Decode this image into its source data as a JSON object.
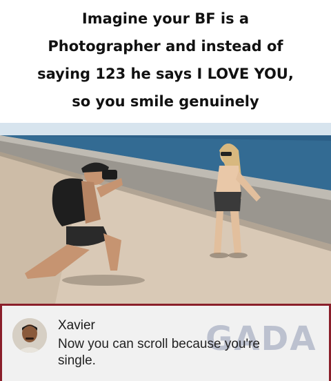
{
  "caption": {
    "lines": [
      "Imagine your BF is a",
      "Photographer and instead of",
      "saying 123 he says I LOVE YOU,",
      "so you smile genuinely"
    ]
  },
  "photo": {
    "colors": {
      "sky": "#d7e4ee",
      "sea": "#2c5f87",
      "pier": "#d9c9b6",
      "wall": "#8f8c86"
    }
  },
  "comment": {
    "author": "Xavier",
    "text": "Now you can scroll because you're single.",
    "watermark": "GADA"
  },
  "theme": {
    "frame_color": "#8a1f2a",
    "card_bg": "#f1f1f1"
  }
}
